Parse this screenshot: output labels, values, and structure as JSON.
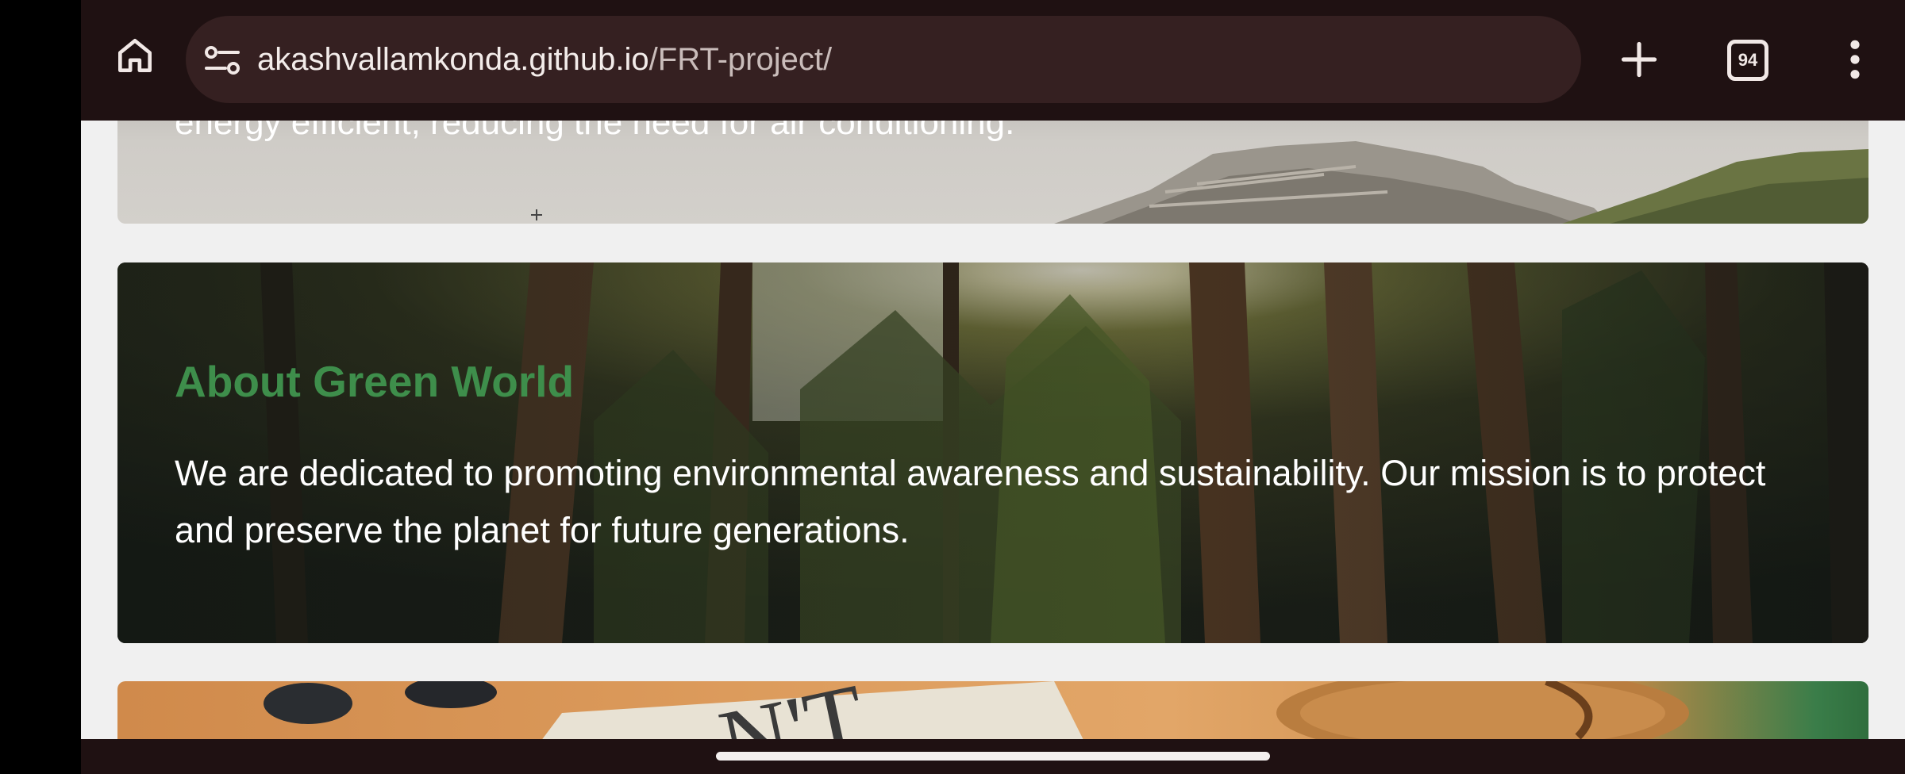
{
  "browser": {
    "url_host": "akashvallamkonda.github.io",
    "url_path": "/FRT-project/",
    "tab_count": "94",
    "icons": {
      "home": "home-icon",
      "site_info": "site-info-icon",
      "new_tab": "plus-icon",
      "tabs": "tab-switcher-icon",
      "menu": "more-vert-icon"
    }
  },
  "page": {
    "mountain_card": {
      "text": "energy efficient, reducing the need for air conditioning."
    },
    "about": {
      "title": "About Green World",
      "body": "We are dedicated to promoting environmental awareness and sustainability. Our mission is to protect and preserve the planet for future generations."
    },
    "next_card_text": "N'T"
  },
  "colors": {
    "toolbar_bg": "#1f1112",
    "url_bar_bg": "#352021",
    "page_bg": "#f0f0f0",
    "title_green": "#3e8e4b",
    "body_text": "#ffffff"
  }
}
